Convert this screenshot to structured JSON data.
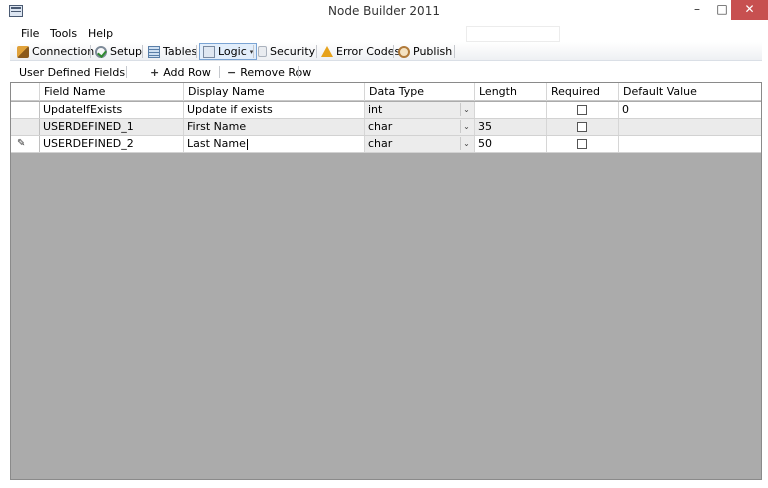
{
  "window": {
    "title": "Node Builder 2011",
    "minimize_glyph": "–",
    "maximize_glyph": "□",
    "close_glyph": "✕"
  },
  "menu": {
    "items": [
      "File",
      "Tools",
      "Help"
    ]
  },
  "toolbar": {
    "connection": "Connection",
    "setup": "Setup",
    "tables": "Tables",
    "logic": "Logic",
    "security": "Security",
    "error_codes": "Error Codes",
    "publish": "Publish",
    "dropdown_glyph": "▾",
    "active_item": "Logic"
  },
  "subtoolbar": {
    "section_label": "User Defined Fields",
    "add_row": "Add Row",
    "remove_row": "Remove Row",
    "add_glyph": "+",
    "remove_glyph": "−"
  },
  "grid": {
    "columns": [
      "",
      "Field Name",
      "Display Name",
      "Data Type",
      "Length",
      "Required",
      "Default Value"
    ],
    "rows": [
      {
        "indicator": "",
        "field_name": "UpdateIfExists",
        "display_name": "Update if exists",
        "data_type": "int",
        "length": "",
        "required": false,
        "default_value": "0"
      },
      {
        "indicator": "",
        "field_name": "USERDEFINED_1",
        "display_name": "First Name",
        "data_type": "char",
        "length": "35",
        "required": false,
        "default_value": ""
      },
      {
        "indicator": "✎",
        "field_name": "USERDEFINED_2",
        "display_name": "Last Name",
        "data_type": "char",
        "length": "50",
        "required": false,
        "default_value": ""
      }
    ],
    "select_arrow_glyph": "⌄"
  },
  "colors": {
    "grid_background": "#ababab",
    "close_button": "#c75050",
    "active_toolbar_border": "#7aa4d4"
  }
}
